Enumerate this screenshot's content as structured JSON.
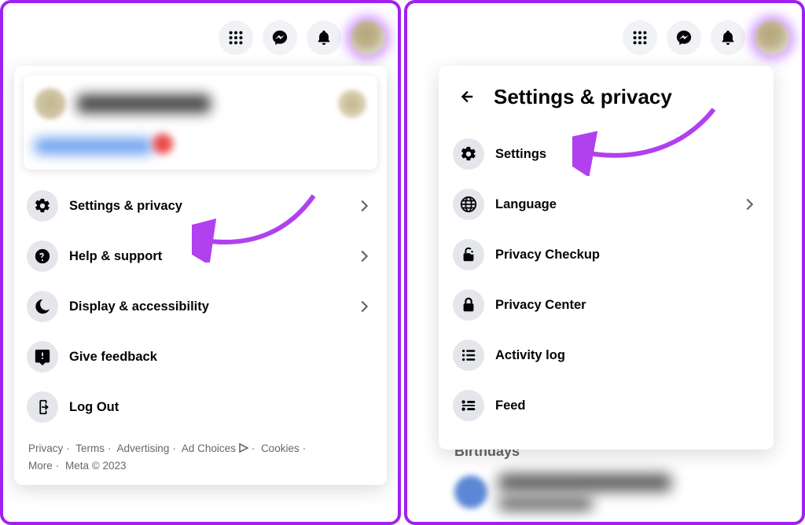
{
  "left": {
    "menu": [
      {
        "icon": "gear-icon",
        "label": "Settings & privacy",
        "chevron": true
      },
      {
        "icon": "question-icon",
        "label": "Help & support",
        "chevron": true
      },
      {
        "icon": "moon-icon",
        "label": "Display & accessibility",
        "chevron": true
      },
      {
        "icon": "feedback-icon",
        "label": "Give feedback",
        "chevron": false
      },
      {
        "icon": "logout-icon",
        "label": "Log Out",
        "chevron": false
      }
    ],
    "footer": {
      "links": [
        "Privacy",
        "Terms",
        "Advertising",
        "Ad Choices",
        "Cookies",
        "More"
      ],
      "copyright": "Meta © 2023"
    }
  },
  "right": {
    "title": "Settings & privacy",
    "menu": [
      {
        "icon": "gear-icon",
        "label": "Settings",
        "chevron": false
      },
      {
        "icon": "globe-icon",
        "label": "Language",
        "chevron": true
      },
      {
        "icon": "lock-heart-icon",
        "label": "Privacy Checkup",
        "chevron": false
      },
      {
        "icon": "lock-icon",
        "label": "Privacy Center",
        "chevron": false
      },
      {
        "icon": "list-icon",
        "label": "Activity log",
        "chevron": false
      },
      {
        "icon": "feed-icon",
        "label": "Feed",
        "chevron": false
      }
    ],
    "behind_section_title": "Birthdays"
  },
  "annotation_color": "#b140ef"
}
